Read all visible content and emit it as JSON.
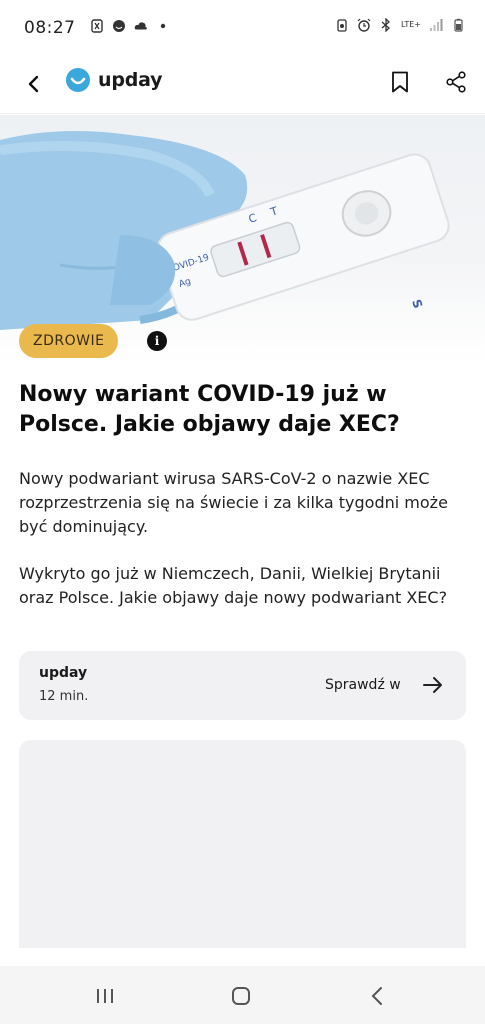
{
  "status_bar": {
    "time": "08:27",
    "left_icons": [
      "clock-alarm-icon",
      "notification-face-icon",
      "cloud-icon",
      "dot-icon"
    ],
    "right_icons": [
      "battery-saver-icon",
      "alarm-icon",
      "bluetooth-icon",
      "lte-icon",
      "signal-icon",
      "battery-icon"
    ],
    "lte_label": "LTE+"
  },
  "header": {
    "brand_name": "upday",
    "brand_color": "#3aa8dc"
  },
  "hero": {
    "category": "ZDROWIE",
    "category_color": "#e9b94d",
    "info_label": "i",
    "test_text_line1": "COVID-19",
    "test_text_line2": "Ag",
    "test_marks": [
      "C",
      "T",
      "S"
    ]
  },
  "article": {
    "headline": "Nowy wariant COVID-19 już w Polsce. Jakie objawy daje XEC?",
    "lead": "Nowy podwariant wirusa SARS-CoV-2 o nazwie XEC rozprzestrzenia się na świecie i za kilka tygodni może być dominujący.",
    "body": "Wykryto go już w Niemczech, Danii, Wielkiej Brytanii oraz Polsce. Jakie objawy daje nowy podwariant XEC?"
  },
  "source": {
    "name": "upday",
    "time": "12 min.",
    "check_label": "Sprawdź w"
  }
}
